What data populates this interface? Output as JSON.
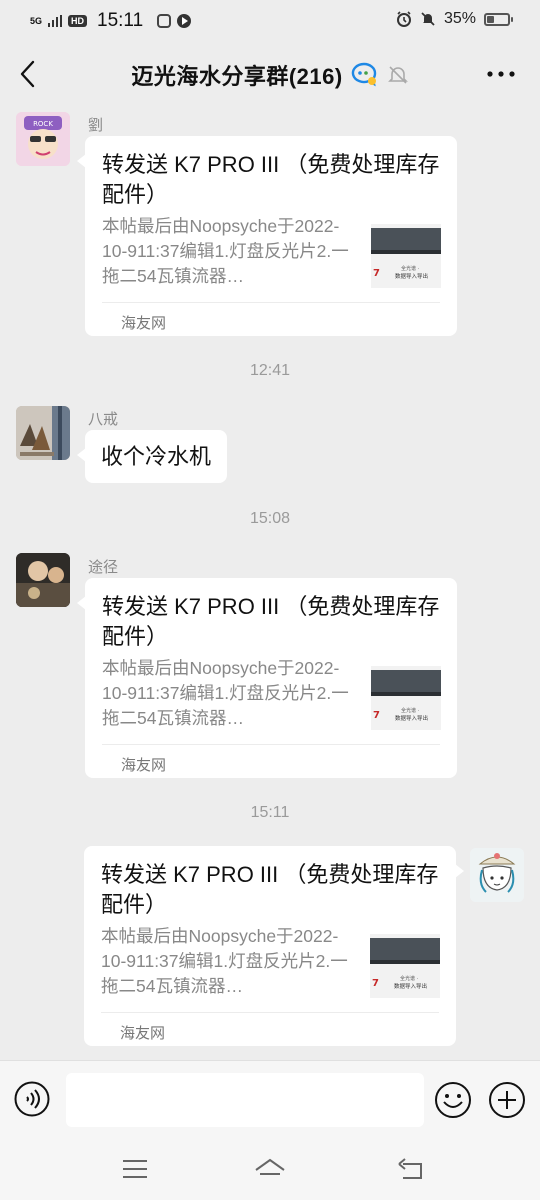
{
  "status_bar": {
    "network": "5G",
    "hd_badge": "HD",
    "time": "15:11",
    "battery_text": "35%",
    "battery_level": 0.35
  },
  "header": {
    "title": "迈光海水分享群(216)"
  },
  "messages": [
    {
      "type": "card",
      "side": "left",
      "sender": "劉",
      "title": "转发送 K7 PRO III （免费处理库存配件）",
      "desc": "本帖最后由Noopsyche于2022-10-911:37编辑1.灯盘反光片2.一拖二54瓦镇流器…",
      "source": "海友网"
    },
    {
      "type": "time",
      "text": "12:41"
    },
    {
      "type": "text",
      "side": "left",
      "sender": "八戒",
      "text": "收个冷水机"
    },
    {
      "type": "time",
      "text": "15:08"
    },
    {
      "type": "card",
      "side": "left",
      "sender": "途径",
      "title": "转发送 K7 PRO III （免费处理库存配件）",
      "desc": "本帖最后由Noopsyche于2022-10-911:37编辑1.灯盘反光片2.一拖二54瓦镇流器…",
      "source": "海友网"
    },
    {
      "type": "time",
      "text": "15:11"
    },
    {
      "type": "card",
      "side": "right",
      "title": "转发送 K7 PRO III （免费处理库存配件）",
      "desc": "本帖最后由Noopsyche于2022-10-911:37编辑1.灯盘反光片2.一拖二54瓦镇流器…",
      "source": "海友网"
    }
  ],
  "thumb": {
    "caption_line1": "全光谱 · ",
    "caption_line2": "数据导入导出"
  },
  "input_bar": {
    "value": ""
  },
  "colors": {
    "background": "#ededed",
    "bubble": "#ffffff",
    "secondary_text": "#888888",
    "time_text": "#9a9a9a"
  },
  "icons": {
    "back": "chevron-left-icon",
    "chat_badge": "chat-bubble-icon",
    "mute": "bell-off-icon",
    "more": "more-dots-icon",
    "voice": "voice-icon",
    "emoji": "emoji-icon",
    "plus": "plus-icon"
  }
}
